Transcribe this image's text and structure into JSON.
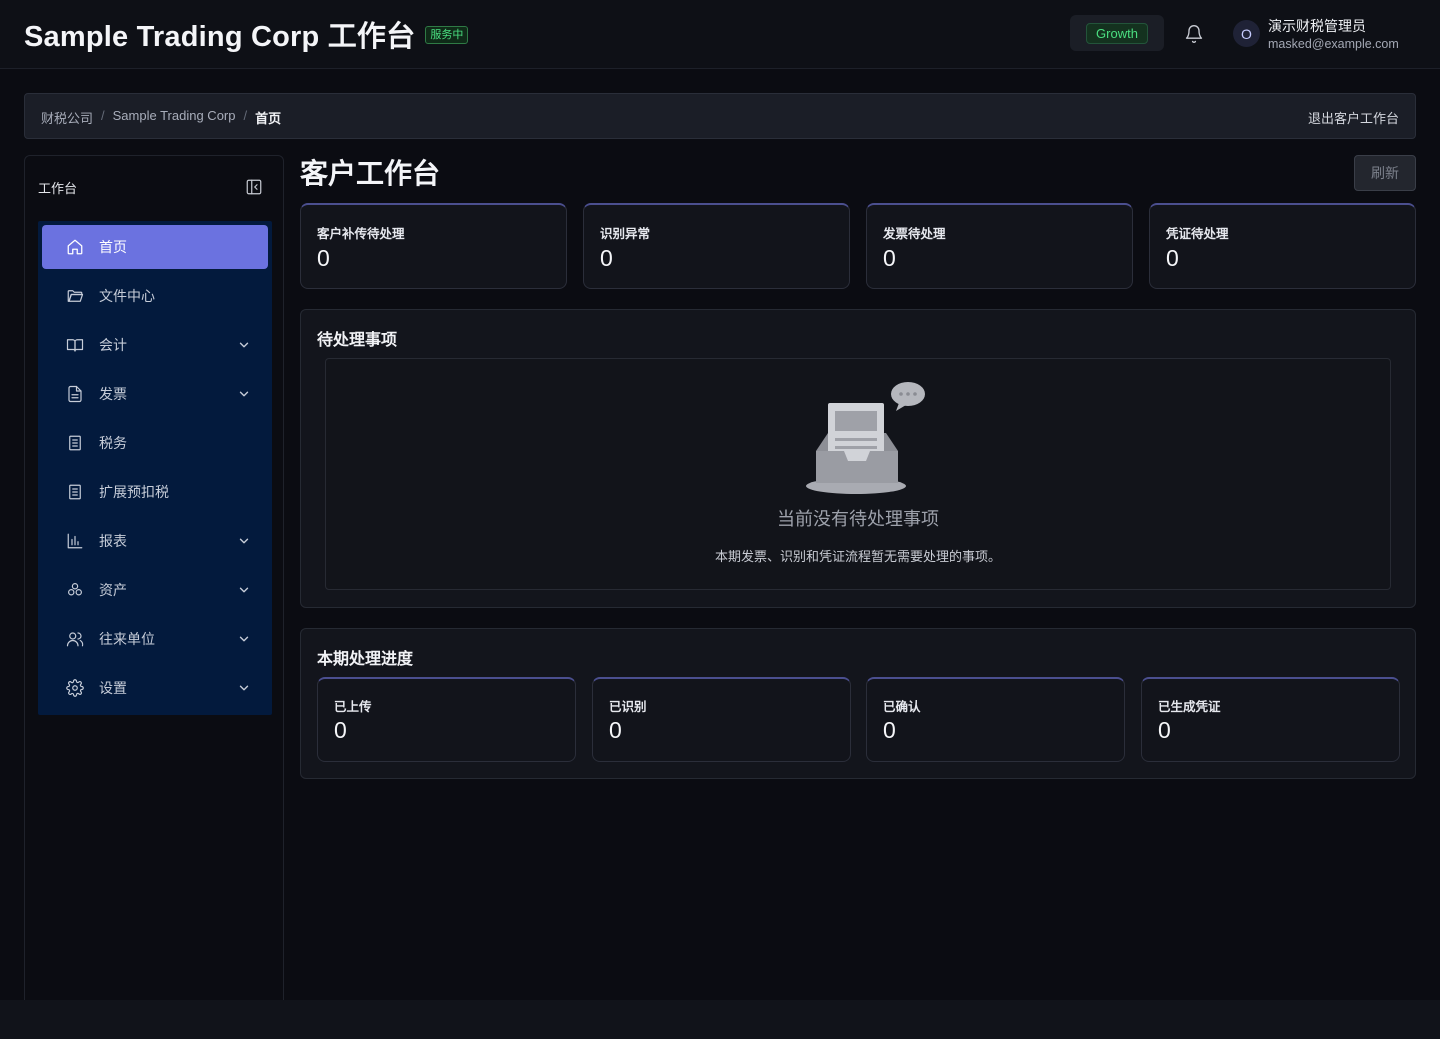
{
  "header": {
    "title": "Sample Trading Corp 工作台",
    "status_badge": "服务中",
    "plan": "Growth",
    "user_initial": "O",
    "user_name": "演示财税管理员",
    "user_email": "masked@example.com"
  },
  "breadcrumb": {
    "items": [
      "财税公司",
      "Sample Trading Corp",
      "首页"
    ],
    "exit_label": "退出客户工作台"
  },
  "sidebar": {
    "title": "工作台",
    "items": [
      {
        "label": "首页",
        "icon": "home-icon",
        "active": true
      },
      {
        "label": "文件中心",
        "icon": "folder-icon"
      },
      {
        "label": "会计",
        "icon": "book-icon",
        "expandable": true
      },
      {
        "label": "发票",
        "icon": "file-text-icon",
        "expandable": true
      },
      {
        "label": "税务",
        "icon": "document-icon"
      },
      {
        "label": "扩展预扣税",
        "icon": "document-icon"
      },
      {
        "label": "报表",
        "icon": "bar-chart-icon",
        "expandable": true
      },
      {
        "label": "资产",
        "icon": "cubes-icon",
        "expandable": true
      },
      {
        "label": "往来单位",
        "icon": "users-icon",
        "expandable": true
      },
      {
        "label": "设置",
        "icon": "gear-icon",
        "expandable": true
      }
    ]
  },
  "main": {
    "title": "客户工作台",
    "refresh_label": "刷新",
    "stats": [
      {
        "label": "客户补传待处理",
        "value": "0"
      },
      {
        "label": "识别异常",
        "value": "0"
      },
      {
        "label": "发票待处理",
        "value": "0"
      },
      {
        "label": "凭证待处理",
        "value": "0"
      }
    ],
    "pending": {
      "title": "待处理事项",
      "empty_title": "当前没有待处理事项",
      "empty_desc": "本期发票、识别和凭证流程暂无需要处理的事项。"
    },
    "progress": {
      "title": "本期处理进度",
      "items": [
        {
          "label": "已上传",
          "value": "0"
        },
        {
          "label": "已识别",
          "value": "0"
        },
        {
          "label": "已确认",
          "value": "0"
        },
        {
          "label": "已生成凭证",
          "value": "0"
        }
      ]
    }
  },
  "colors": {
    "accent": "#6b72e0",
    "success": "#4ade80",
    "sidebar_menu_bg": "#031a3d"
  }
}
